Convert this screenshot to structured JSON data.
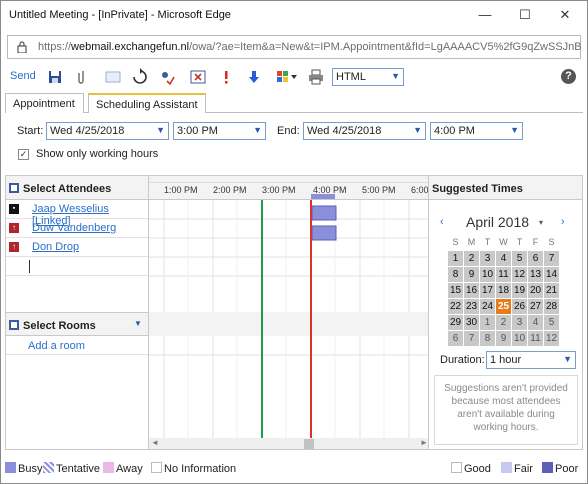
{
  "window": {
    "title": "Untitled Meeting - [InPrivate] - Microsoft Edge",
    "controls": {
      "minimize": "—",
      "maximize": "☐",
      "close": "✕"
    }
  },
  "address": {
    "url_domain_prefix": "https://",
    "url_domain": "webmail.exchangefun.nl",
    "url_rest": "/owa/?ae=Item&a=New&t=IPM.Appointment&fId=LgAAAACV5%2fG9qZwSSJnB"
  },
  "toolbar": {
    "send_label": "Send",
    "format_value": "HTML",
    "help_label": "?"
  },
  "tabs": [
    {
      "label": "Appointment"
    },
    {
      "label": "Scheduling Assistant"
    }
  ],
  "times": {
    "start_label": "Start:",
    "start_date": "Wed 4/25/2018",
    "start_time": "3:00 PM",
    "end_label": "End:",
    "end_date": "Wed 4/25/2018",
    "end_time": "4:00 PM",
    "working_hours_label": "Show only working hours",
    "working_hours_checked": true
  },
  "attendees": {
    "header": "Select Attendees",
    "items": [
      {
        "name": "Jaap Wesselius [Linked]",
        "icon": "organizer-icon"
      },
      {
        "name": "Duw Vandenberg",
        "icon": "required-attendee-icon"
      },
      {
        "name": "Don Drop",
        "icon": "required-attendee-icon"
      }
    ]
  },
  "rooms": {
    "header": "Select Rooms",
    "add_label": "Add a room"
  },
  "timeline": {
    "hours": [
      "1:00 PM",
      "2:00 PM",
      "3:00 PM",
      "4:00 PM",
      "5:00 PM",
      "6:00"
    ]
  },
  "suggested": {
    "header": "Suggested Times",
    "month_label": "April 2018",
    "weekdays": [
      "S",
      "M",
      "T",
      "W",
      "T",
      "F",
      "S"
    ],
    "weeks": [
      [
        "1",
        "2",
        "3",
        "4",
        "5",
        "6",
        "7"
      ],
      [
        "8",
        "9",
        "10",
        "11",
        "12",
        "13",
        "14"
      ],
      [
        "15",
        "16",
        "17",
        "18",
        "19",
        "20",
        "21"
      ],
      [
        "22",
        "23",
        "24",
        "25",
        "26",
        "27",
        "28"
      ],
      [
        "29",
        "30",
        "1",
        "2",
        "3",
        "4",
        "5"
      ],
      [
        "6",
        "7",
        "8",
        "9",
        "10",
        "11",
        "12"
      ]
    ],
    "selected_day": "25",
    "duration_label": "Duration:",
    "duration_value": "1 hour",
    "message": "Suggestions aren't provided because most attendees aren't available during working hours."
  },
  "legend": {
    "busy": "Busy",
    "tentative": "Tentative",
    "away": "Away",
    "no_info": "No Information",
    "good": "Good",
    "fair": "Fair",
    "poor": "Poor"
  },
  "colors": {
    "busy": "#8b8fd9",
    "tentative_border": "#8b8fd9",
    "away": "#e6b9e6",
    "now_line": "#d9332a",
    "start_line": "#1f9a4a",
    "selected_day": "#e87b1c",
    "accent": "#2a6fc9"
  }
}
